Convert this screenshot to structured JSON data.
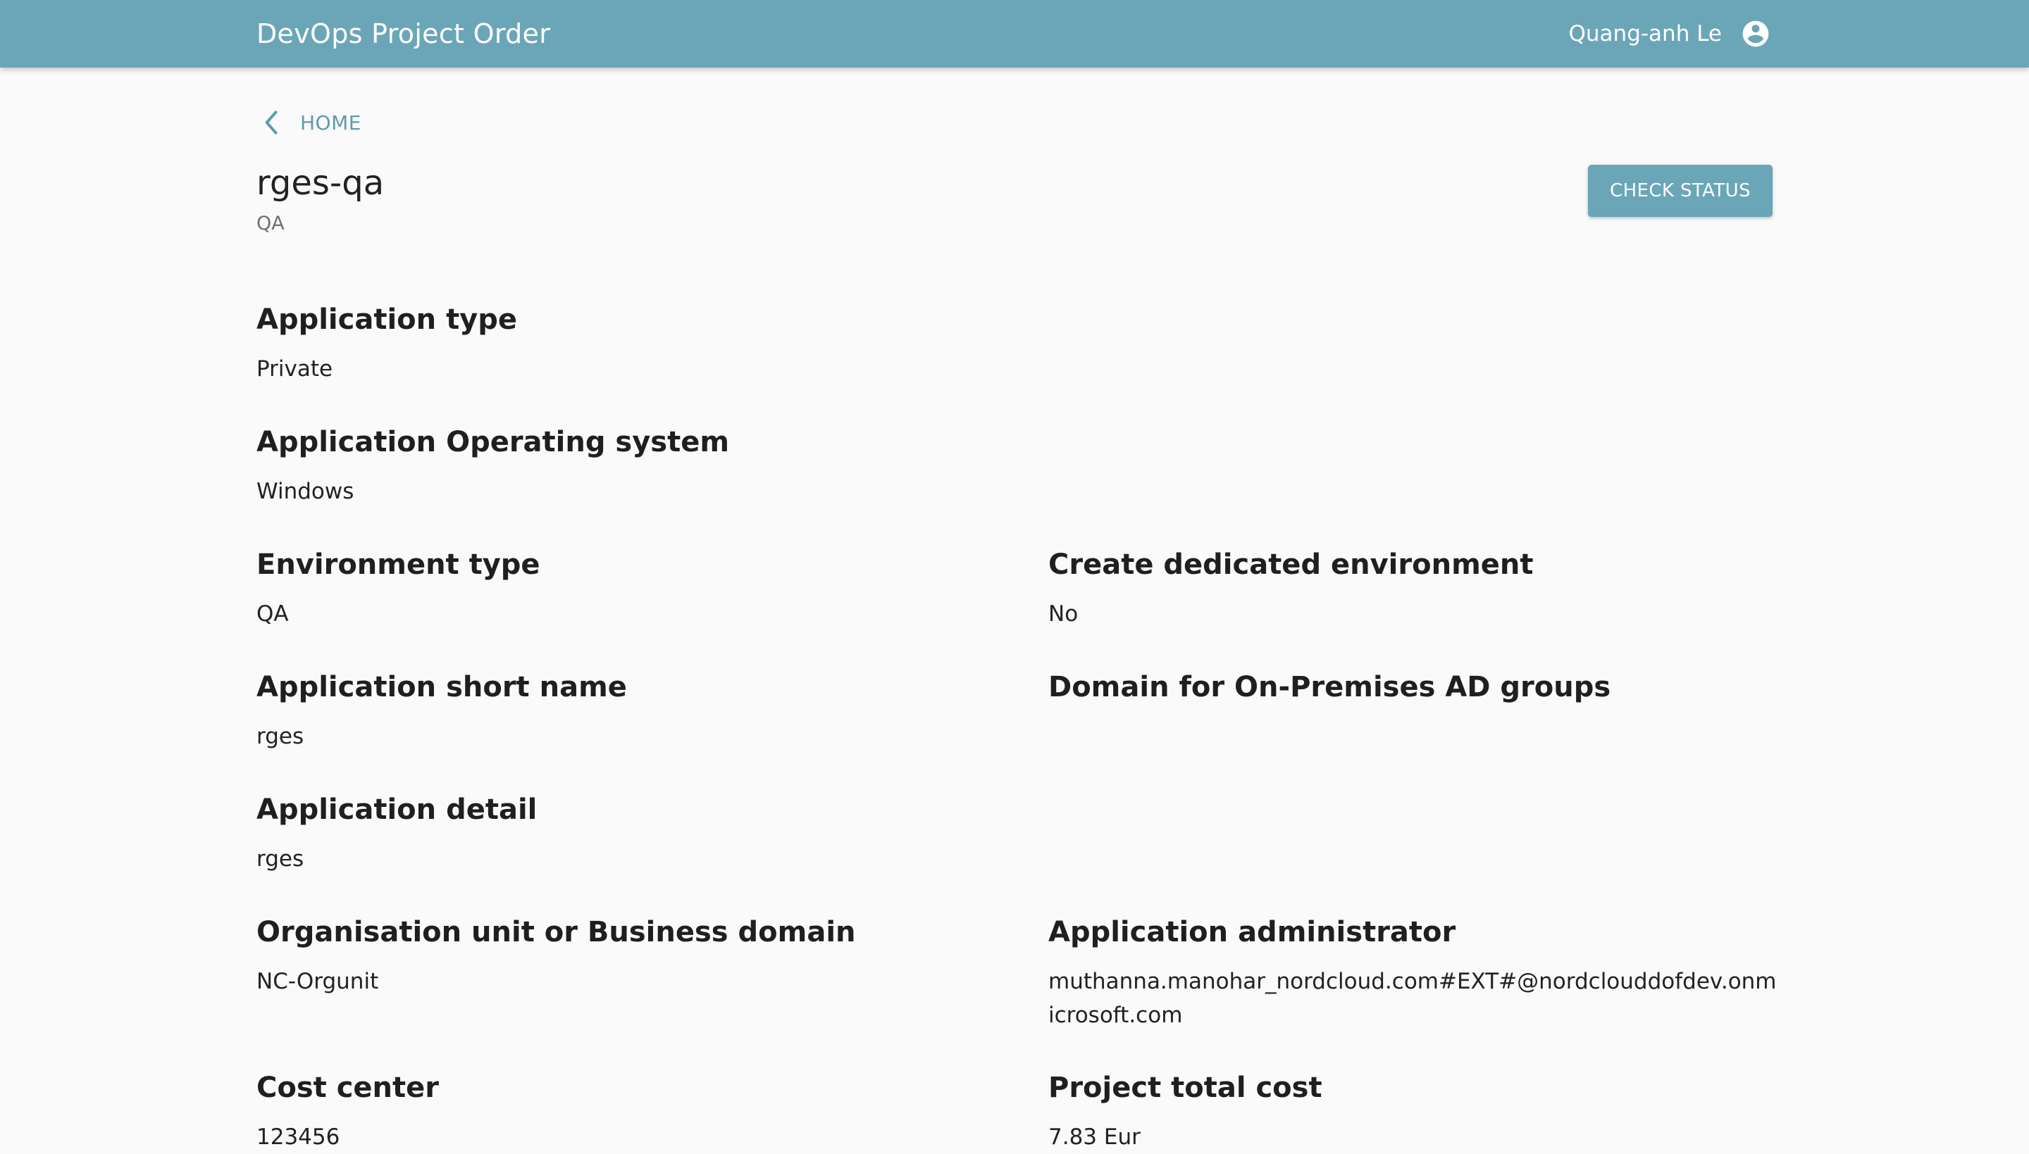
{
  "header": {
    "app_title": "DevOps Project Order",
    "user_name": "Quang-anh Le",
    "user_icon": "account-circle-icon"
  },
  "navigation": {
    "back_label": "HOME",
    "back_icon": "chevron-left-icon"
  },
  "project": {
    "title": "rges-qa",
    "subtitle": "QA",
    "check_status_label": "CHECK STATUS"
  },
  "fields": {
    "application_type": {
      "label": "Application type",
      "value": "Private"
    },
    "application_os": {
      "label": "Application Operating system",
      "value": "Windows"
    },
    "environment_type": {
      "label": "Environment type",
      "value": "QA"
    },
    "dedicated_env": {
      "label": "Create dedicated environment",
      "value": "No"
    },
    "short_name": {
      "label": "Application short name",
      "value": "rges"
    },
    "ad_domain": {
      "label": "Domain for On-Premises AD groups",
      "value": ""
    },
    "app_detail": {
      "label": "Application detail",
      "value": "rges"
    },
    "org_unit": {
      "label": "Organisation unit or Business domain",
      "value": "NC-Orgunit"
    },
    "app_admin": {
      "label": "Application administrator",
      "value": "muthanna.manohar_nordcloud.com#EXT#@nordclouddofdev.onmicrosoft.com"
    },
    "cost_center": {
      "label": "Cost center",
      "value": "123456"
    },
    "total_cost": {
      "label": "Project total cost",
      "value": "7.83 Eur"
    }
  },
  "colors": {
    "primary": "#6aa6b8",
    "link": "#5c9bae",
    "background": "#fafafa"
  }
}
